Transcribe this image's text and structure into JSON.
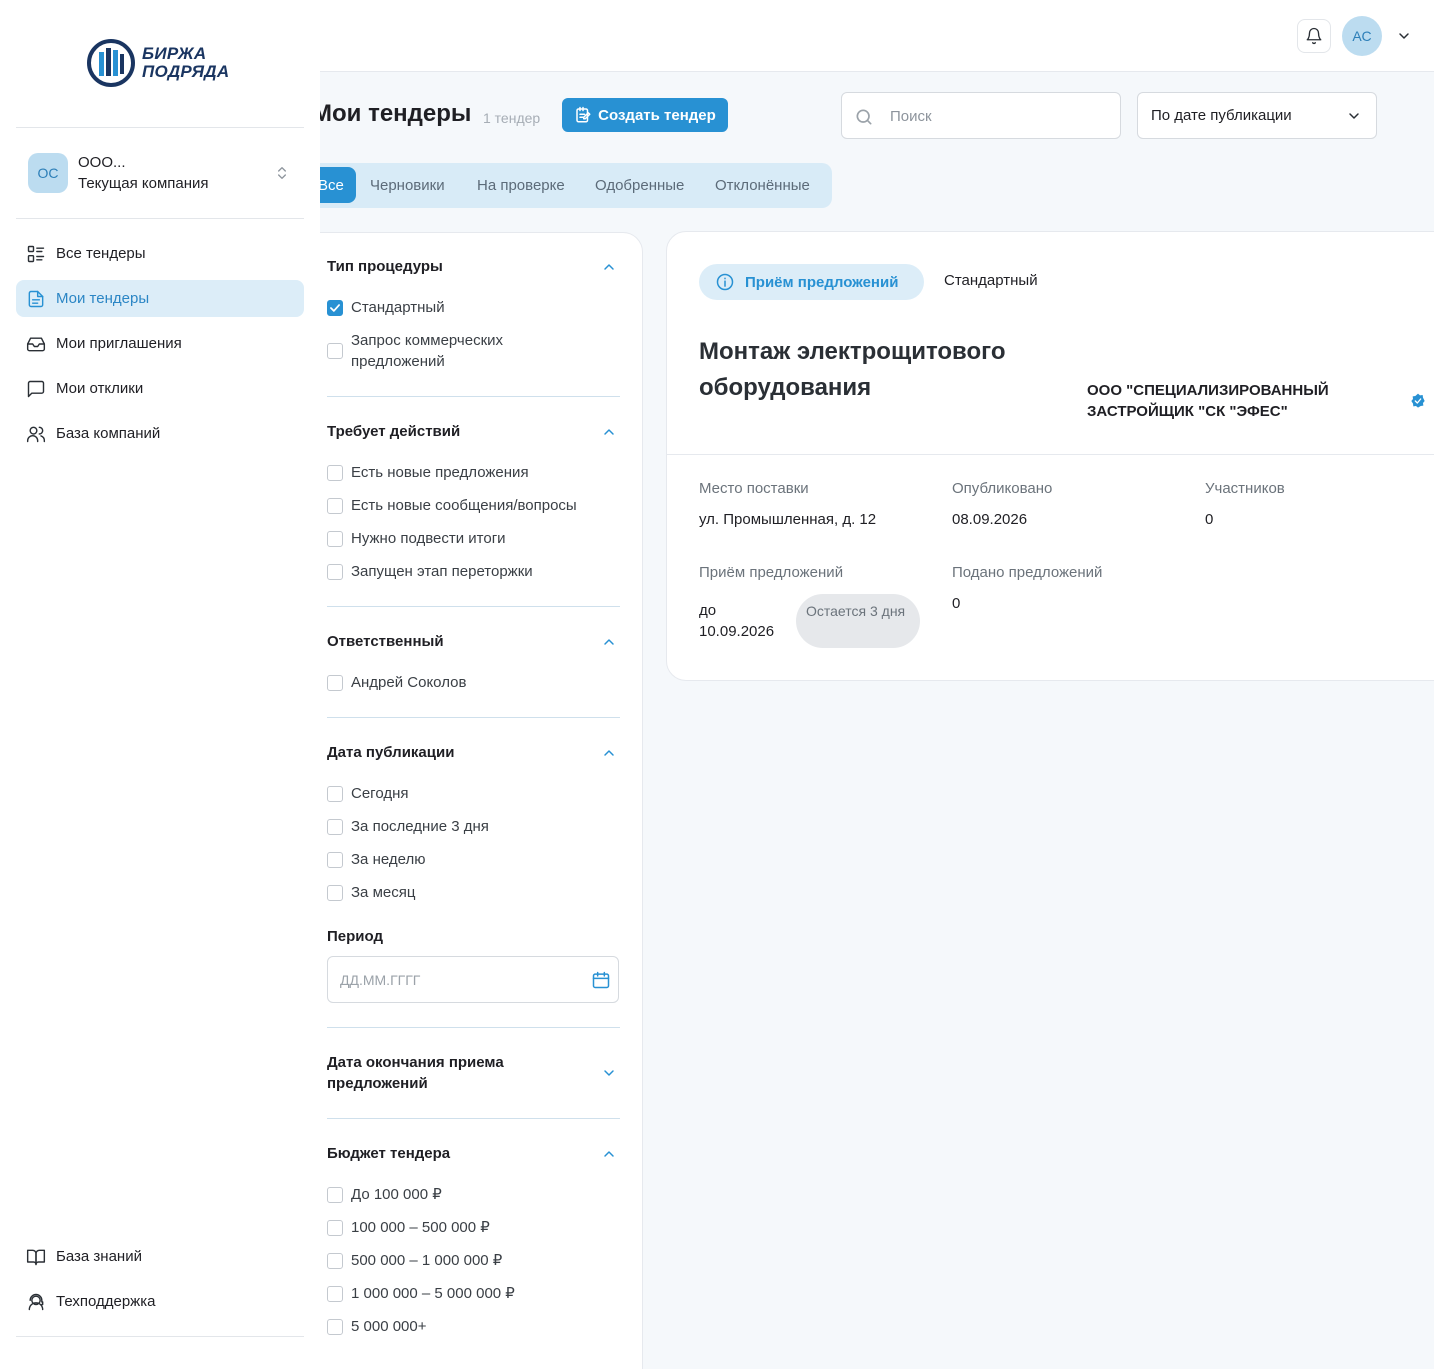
{
  "brand": {
    "line1": "БИРЖА",
    "line2": "ПОДРЯДА"
  },
  "company": {
    "initials": "ОС",
    "name": "ООО...",
    "subtitle": "Текущая компания"
  },
  "sidebar": {
    "items": [
      {
        "label": "Все тендеры",
        "icon": "list-icon"
      },
      {
        "label": "Мои тендеры",
        "icon": "document-icon",
        "active": true
      },
      {
        "label": "Мои приглашения",
        "icon": "inbox-icon"
      },
      {
        "label": "Мои отклики",
        "icon": "chat-icon"
      },
      {
        "label": "База компаний",
        "icon": "users-icon"
      }
    ],
    "bottom": [
      {
        "label": "База знаний",
        "icon": "book-icon"
      },
      {
        "label": "Техподдержка",
        "icon": "support-icon"
      }
    ]
  },
  "header": {
    "user_initials": "АС"
  },
  "page": {
    "title": "Мои тендеры",
    "count": "1 тендер",
    "create_label": "Создать тендер",
    "search_placeholder": "Поиск",
    "sort_value": "По дате публикации"
  },
  "tabs": [
    "Все",
    "Черновики",
    "На проверке",
    "Одобренные",
    "Отклонённые"
  ],
  "filters": {
    "procedure": {
      "title": "Тип процедуры",
      "options": [
        {
          "label": "Стандартный",
          "checked": true
        },
        {
          "label": "Запрос коммерческих предложений",
          "checked": false
        }
      ]
    },
    "actions": {
      "title": "Требует действий",
      "options": [
        "Есть новые предложения",
        "Есть новые сообщения/вопросы",
        "Нужно подвести итоги",
        "Запущен этап переторжки"
      ]
    },
    "responsible": {
      "title": "Ответственный",
      "options": [
        "Андрей Соколов"
      ]
    },
    "pub_date": {
      "title": "Дата публикации",
      "options": [
        "Сегодня",
        "За последние 3 дня",
        "За неделю",
        "За месяц"
      ],
      "period_label": "Период",
      "period_placeholder": "ДД.ММ.ГГГГ"
    },
    "end_date": {
      "title": "Дата окончания приема предложений"
    },
    "budget": {
      "title": "Бюджет тендера",
      "options": [
        "До 100 000 ₽",
        "100 000 – 500 000 ₽",
        "500 000 – 1 000 000 ₽",
        "1 000 000 – 5 000 000 ₽",
        "5 000 000+"
      ]
    }
  },
  "tender": {
    "status": "Приём предложений",
    "type": "Стандартный",
    "title": "Монтаж электрощитового оборудования",
    "customer": "ООО \"СПЕЦИАЛИЗИРОВАННЫЙ ЗАСТРОЙЩИК \"СК \"ЭФЕС\"",
    "place_label": "Место поставки",
    "place": "ул. Промышленная, д. 12",
    "published_label": "Опубликовано",
    "published": "08.09.2026",
    "participants_label": "Участников",
    "participants": "0",
    "deadline_label": "Приём предложений",
    "deadline": "до 10.09.2026",
    "days_left": "Остается 3 дня",
    "submitted_label": "Подано предложений",
    "submitted": "0"
  },
  "colors": {
    "accent": "#2891d3",
    "brand": "#1a3561",
    "accent_light": "#dcedf8"
  }
}
